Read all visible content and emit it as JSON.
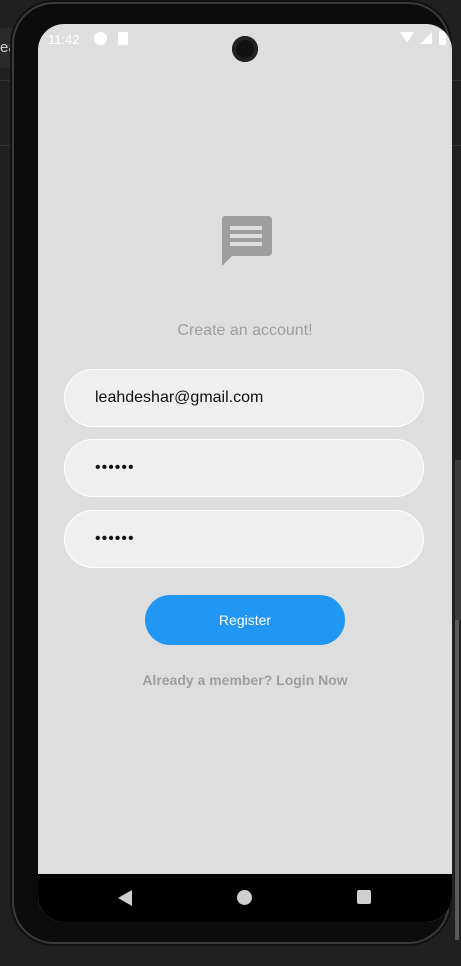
{
  "background": {
    "tab_label": "ea"
  },
  "status_bar": {
    "time": "11:42"
  },
  "screen": {
    "headline": "Create an account!",
    "email_value": "leahdeshar@gmail.com",
    "password_value": "••••••",
    "confirm_password_value": "••••••",
    "register_label": "Register",
    "login_link": "Already a member? Login Now"
  },
  "colors": {
    "screen_bg": "#dedede",
    "field_bg": "#efefef",
    "accent": "#2196f3",
    "muted_text": "#9e9e9e"
  },
  "icons": {
    "logo": "message-icon",
    "nav_back": "back-triangle-icon",
    "nav_home": "home-circle-icon",
    "nav_recents": "recents-square-icon"
  }
}
